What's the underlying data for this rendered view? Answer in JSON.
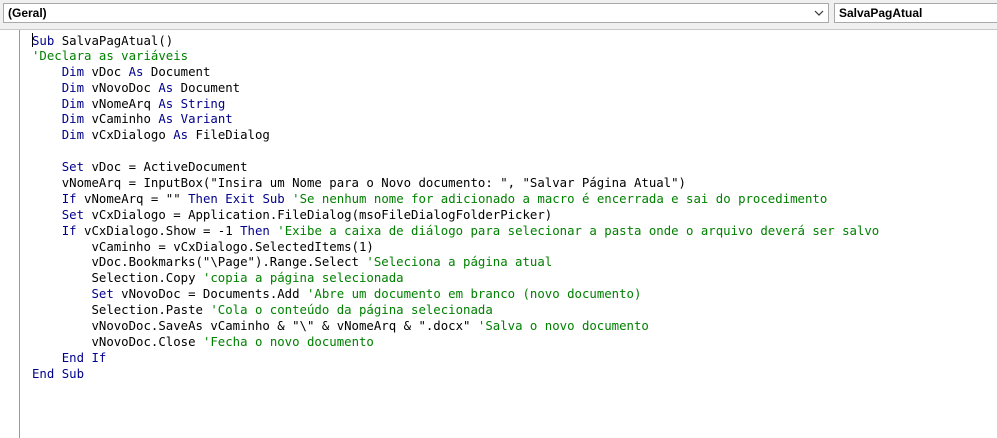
{
  "toolbar": {
    "object_combo": "(Geral)",
    "procedure_combo": "SalvaPagAtual"
  },
  "colors": {
    "keyword": "#00008b",
    "comment": "#008000",
    "text": "#000000"
  },
  "code_lines": [
    [
      [
        "k",
        "Sub"
      ],
      [
        "t",
        " SalvaPagAtual()"
      ]
    ],
    [
      [
        "c",
        "'Declara as variáveis"
      ]
    ],
    [
      [
        "t",
        "    "
      ],
      [
        "k",
        "Dim"
      ],
      [
        "t",
        " vDoc "
      ],
      [
        "k",
        "As"
      ],
      [
        "t",
        " Document"
      ]
    ],
    [
      [
        "t",
        "    "
      ],
      [
        "k",
        "Dim"
      ],
      [
        "t",
        " vNovoDoc "
      ],
      [
        "k",
        "As"
      ],
      [
        "t",
        " Document"
      ]
    ],
    [
      [
        "t",
        "    "
      ],
      [
        "k",
        "Dim"
      ],
      [
        "t",
        " vNomeArq "
      ],
      [
        "k",
        "As"
      ],
      [
        "t",
        " "
      ],
      [
        "k",
        "String"
      ]
    ],
    [
      [
        "t",
        "    "
      ],
      [
        "k",
        "Dim"
      ],
      [
        "t",
        " vCaminho "
      ],
      [
        "k",
        "As"
      ],
      [
        "t",
        " "
      ],
      [
        "k",
        "Variant"
      ]
    ],
    [
      [
        "t",
        "    "
      ],
      [
        "k",
        "Dim"
      ],
      [
        "t",
        " vCxDialogo "
      ],
      [
        "k",
        "As"
      ],
      [
        "t",
        " FileDialog"
      ]
    ],
    [
      [
        "t",
        ""
      ]
    ],
    [
      [
        "t",
        "    "
      ],
      [
        "k",
        "Set"
      ],
      [
        "t",
        " vDoc = ActiveDocument"
      ]
    ],
    [
      [
        "t",
        "    vNomeArq = InputBox(\"Insira um Nome para o Novo documento: \", \"Salvar Página Atual\")"
      ]
    ],
    [
      [
        "t",
        "    "
      ],
      [
        "k",
        "If"
      ],
      [
        "t",
        " vNomeArq = \"\" "
      ],
      [
        "k",
        "Then"
      ],
      [
        "t",
        " "
      ],
      [
        "k",
        "Exit"
      ],
      [
        "t",
        " "
      ],
      [
        "k",
        "Sub"
      ],
      [
        "t",
        " "
      ],
      [
        "c",
        "'Se nenhum nome for adicionado a macro é encerrada e sai do procedimento"
      ]
    ],
    [
      [
        "t",
        "    "
      ],
      [
        "k",
        "Set"
      ],
      [
        "t",
        " vCxDialogo = Application.FileDialog(msoFileDialogFolderPicker)"
      ]
    ],
    [
      [
        "t",
        "    "
      ],
      [
        "k",
        "If"
      ],
      [
        "t",
        " vCxDialogo.Show = -1 "
      ],
      [
        "k",
        "Then"
      ],
      [
        "t",
        " "
      ],
      [
        "c",
        "'Exibe a caixa de diálogo para selecionar a pasta onde o arquivo deverá ser salvo"
      ]
    ],
    [
      [
        "t",
        "        vCaminho = vCxDialogo.SelectedItems(1)"
      ]
    ],
    [
      [
        "t",
        "        vDoc.Bookmarks(\"\\Page\").Range.Select "
      ],
      [
        "c",
        "'Seleciona a página atual"
      ]
    ],
    [
      [
        "t",
        "        Selection.Copy "
      ],
      [
        "c",
        "'copia a página selecionada"
      ]
    ],
    [
      [
        "t",
        "        "
      ],
      [
        "k",
        "Set"
      ],
      [
        "t",
        " vNovoDoc = Documents.Add "
      ],
      [
        "c",
        "'Abre um documento em branco (novo documento)"
      ]
    ],
    [
      [
        "t",
        "        Selection.Paste "
      ],
      [
        "c",
        "'Cola o conteúdo da página selecionada"
      ]
    ],
    [
      [
        "t",
        "        vNovoDoc.SaveAs vCaminho & \"\\\" & vNomeArq & \".docx\" "
      ],
      [
        "c",
        "'Salva o novo documento"
      ]
    ],
    [
      [
        "t",
        "        vNovoDoc.Close "
      ],
      [
        "c",
        "'Fecha o novo documento"
      ]
    ],
    [
      [
        "t",
        "    "
      ],
      [
        "k",
        "End If"
      ]
    ],
    [
      [
        "k",
        "End Sub"
      ]
    ]
  ]
}
